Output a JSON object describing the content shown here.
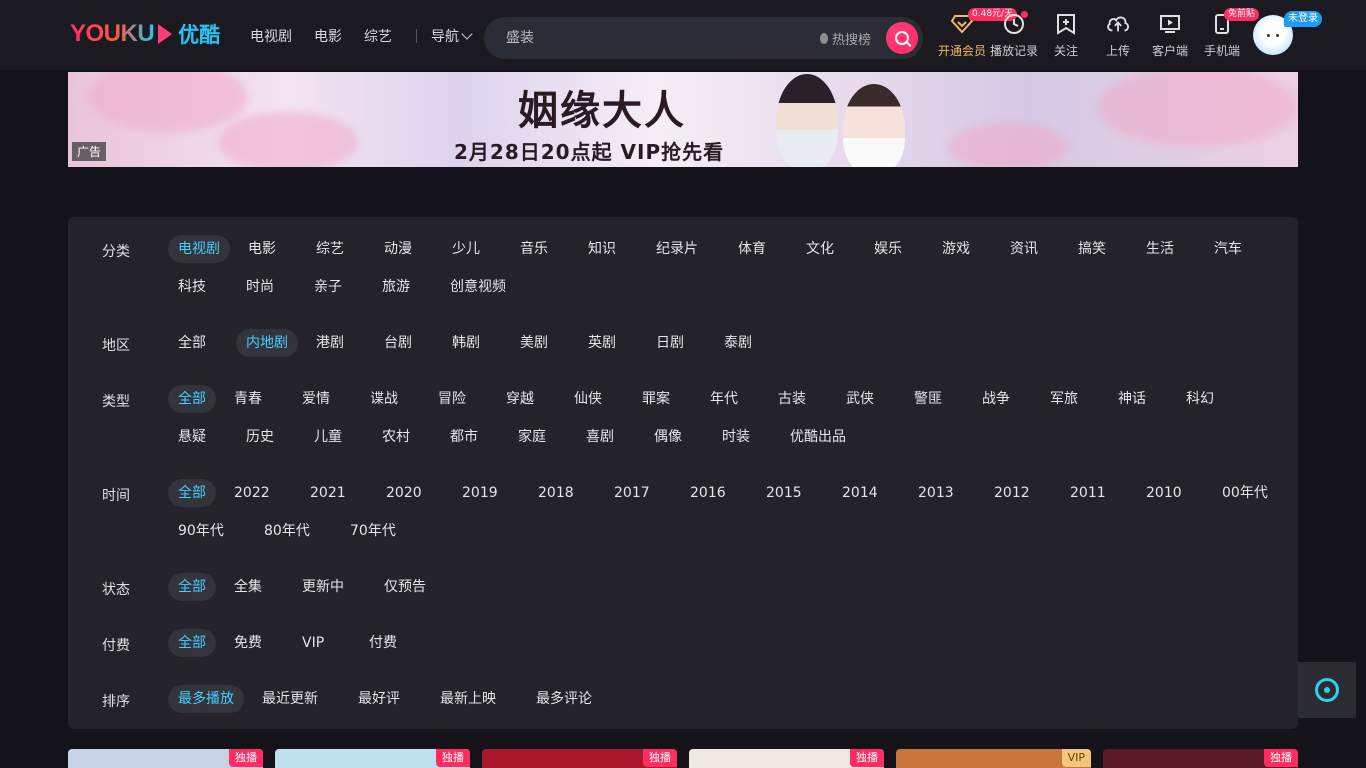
{
  "header": {
    "logo_en": "YOUKU",
    "logo_cn": "优酷",
    "nav": [
      "电视剧",
      "电影",
      "综艺"
    ],
    "nav_more": "导航",
    "search_placeholder": "盛装",
    "hot_label": "热搜榜",
    "tools": [
      {
        "label": "开通会员",
        "icon": "diamond-icon",
        "tag": "0.48元/天"
      },
      {
        "label": "播放记录",
        "icon": "clock-icon"
      },
      {
        "label": "关注",
        "icon": "bookmark-plus-icon"
      },
      {
        "label": "上传",
        "icon": "cloud-upload-icon"
      },
      {
        "label": "客户端",
        "icon": "tv-play-icon"
      },
      {
        "label": "手机端",
        "icon": "phone-icon",
        "tag": "免前贴"
      }
    ],
    "login_tag": "未登录"
  },
  "banner": {
    "title": "姻缘大人",
    "subtitle": "2月28日20点起 VIP抢先看",
    "ad_label": "广告"
  },
  "filters": [
    {
      "label": "分类",
      "options": [
        "电视剧",
        "电影",
        "综艺",
        "动漫",
        "少儿",
        "音乐",
        "知识",
        "纪录片",
        "体育",
        "文化",
        "娱乐",
        "游戏",
        "资讯",
        "搞笑",
        "生活",
        "汽车",
        "科技",
        "时尚",
        "亲子",
        "旅游",
        "创意视频"
      ],
      "active": 0
    },
    {
      "label": "地区",
      "options": [
        "全部",
        "内地剧",
        "港剧",
        "台剧",
        "韩剧",
        "美剧",
        "英剧",
        "日剧",
        "泰剧"
      ],
      "active": 1
    },
    {
      "label": "类型",
      "options": [
        "全部",
        "青春",
        "爱情",
        "谍战",
        "冒险",
        "穿越",
        "仙侠",
        "罪案",
        "年代",
        "古装",
        "武侠",
        "警匪",
        "战争",
        "军旅",
        "神话",
        "科幻",
        "悬疑",
        "历史",
        "儿童",
        "农村",
        "都市",
        "家庭",
        "喜剧",
        "偶像",
        "时装",
        "优酷出品"
      ],
      "active": 0
    },
    {
      "label": "时间",
      "options": [
        "全部",
        "2022",
        "2021",
        "2020",
        "2019",
        "2018",
        "2017",
        "2016",
        "2015",
        "2014",
        "2013",
        "2012",
        "2011",
        "2010",
        "00年代",
        "90年代",
        "80年代",
        "70年代"
      ],
      "active": 0
    },
    {
      "label": "状态",
      "options": [
        "全部",
        "全集",
        "更新中",
        "仅预告"
      ],
      "active": 0
    },
    {
      "label": "付费",
      "options": [
        "全部",
        "免费",
        "VIP",
        "付费"
      ],
      "active": 0
    },
    {
      "label": "排序",
      "options": [
        "最多播放",
        "最近更新",
        "最好评",
        "最新上映",
        "最多评论"
      ],
      "active": 0
    }
  ],
  "cards": [
    {
      "badge": "独播",
      "badge_type": "exclusive",
      "color": "#c8d4e6"
    },
    {
      "badge": "独播",
      "badge_type": "exclusive",
      "color": "#bfe0ee"
    },
    {
      "badge": "独播",
      "badge_type": "exclusive",
      "color": "#a8182a"
    },
    {
      "badge": "独播",
      "badge_type": "exclusive",
      "color": "#f1e8e0"
    },
    {
      "badge": "VIP",
      "badge_type": "vip",
      "color": "#c9743a"
    },
    {
      "badge": "独播",
      "badge_type": "exclusive",
      "color": "#5a1a26"
    }
  ],
  "colors": {
    "accent": "#43d0ff",
    "brand_pink": "#ff2c5f",
    "vip_gold": "#f0b860"
  }
}
